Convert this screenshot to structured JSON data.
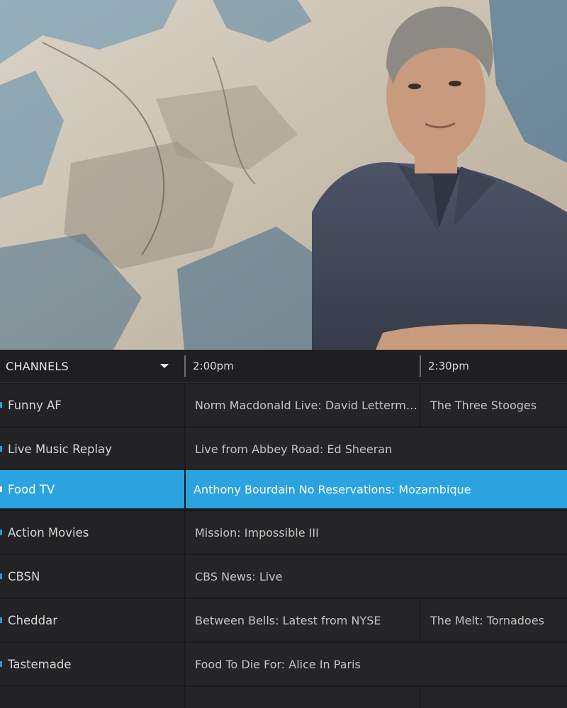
{
  "colors": {
    "accent": "#2aa3de",
    "background": "#1b1b1d",
    "cell": "#252527"
  },
  "hero": {
    "image": "hero-photo"
  },
  "guide": {
    "channels_label": "CHANNELS",
    "times": [
      "2:00pm",
      "2:30pm"
    ],
    "rows": [
      {
        "channel": "Funny AF",
        "programs": [
          "Norm Macdonald Live: David Letterman",
          "The Three Stooges"
        ]
      },
      {
        "channel": "Live Music Replay",
        "programs": [
          "Live from Abbey Road: Ed Sheeran"
        ]
      },
      {
        "channel": "Food TV",
        "programs": [
          "Anthony Bourdain No Reservations: Mozambique"
        ],
        "selected": true
      },
      {
        "channel": "Action Movies",
        "programs": [
          "Mission: Impossible III"
        ]
      },
      {
        "channel": "CBSN",
        "programs": [
          "CBS News: Live"
        ]
      },
      {
        "channel": "Cheddar",
        "programs": [
          "Between Bells: Latest from NYSE",
          "The Melt: Tornadoes"
        ]
      },
      {
        "channel": "Tastemade",
        "programs": [
          "Food To Die For: Alice In Paris"
        ]
      }
    ]
  }
}
